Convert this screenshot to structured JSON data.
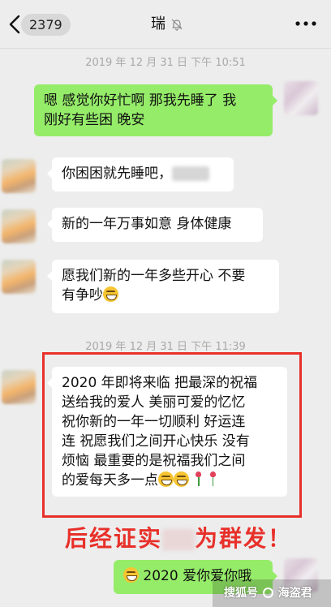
{
  "header": {
    "unread_count": "2379",
    "title": "瑞"
  },
  "messages": {
    "timestamp_1": "2019 年 12 月 31 日 下午 10:51",
    "m1_line1": "嗯 感觉你好忙啊 那我先睡了 我",
    "m1_line2": "刚好有些困 晚安",
    "m2": "你困困就先睡吧，",
    "m3": "新的一年万事如意 身体健康",
    "m4_line1": "愿我们新的一年多些开心 不要",
    "m4_line2": "有争吵",
    "timestamp_2": "2019 年 12 月 31 日 下午 11:39",
    "m5_line1": "2020 年即将来临 把最深的祝福",
    "m5_line2": "送给我的爱人 美丽可爱的忆忆",
    "m5_line3": "祝你新的一年一切顺利 好运连",
    "m5_line4": "连 祝愿我们之间开心快乐 没有",
    "m5_line5": "烦恼 最重要的是祝福我们之间",
    "m5_line6": "的爱每天多一点",
    "m6": "2020 爱你爱你哦"
  },
  "annotation": {
    "part1": "后经证实",
    "part2": "为群发！"
  },
  "watermark": {
    "text1": "搜狐号",
    "text2": "海盗君"
  },
  "colors": {
    "self_bubble": "#95ec69",
    "peer_bubble": "#ffffff",
    "highlight_red": "#e8302a"
  }
}
